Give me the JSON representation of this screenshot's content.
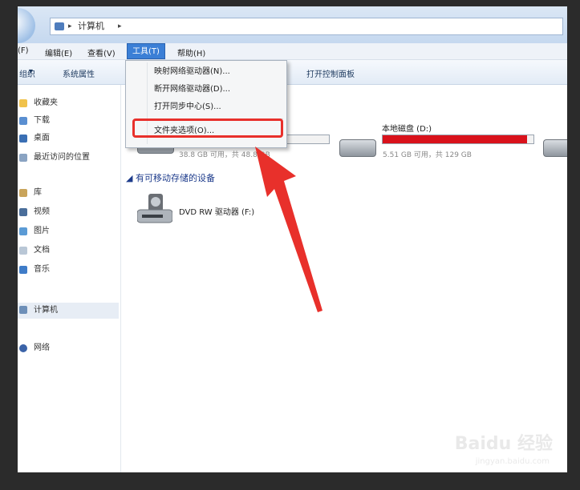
{
  "address_bar": {
    "breadcrumb": "计算机"
  },
  "menubar": {
    "items": [
      "(F)",
      "编辑(E)",
      "查看(V)",
      "工具(T)",
      "帮助(H)"
    ]
  },
  "toolbar": {
    "items": [
      "组织",
      "系统属性",
      "打开控制面板"
    ]
  },
  "tools_menu": {
    "items": [
      "映射网络驱动器(N)...",
      "断开网络驱动器(D)...",
      "打开同步中心(S)...",
      "文件夹选项(O)..."
    ],
    "highlighted": "文件夹选项(O)..."
  },
  "sidebar": {
    "items": [
      "收藏夹",
      "下载",
      "桌面",
      "最近访问的位置",
      "库",
      "视频",
      "图片",
      "文档",
      "音乐",
      "计算机",
      "网络"
    ]
  },
  "content": {
    "drives": [
      {
        "name": "",
        "info": "38.8 GB 可用，共 48.8 GB",
        "used_fraction": 0.2
      },
      {
        "name": "本地磁盘 (D:)",
        "info": "5.51 GB 可用，共 129 GB",
        "used_fraction": 0.96
      }
    ],
    "removable_heading": "有可移动存储的设备",
    "dvd_label": "DVD RW 驱动器 (F:)"
  },
  "watermark": {
    "brand": "Baidu 经验",
    "url": "jingyan.baidu.com"
  },
  "colors": {
    "annotation_red": "#e8302b",
    "drive_full_red": "#d9121b",
    "drive_ok_blue": "#36a2e0",
    "menu_active": "#3b7fd6"
  }
}
